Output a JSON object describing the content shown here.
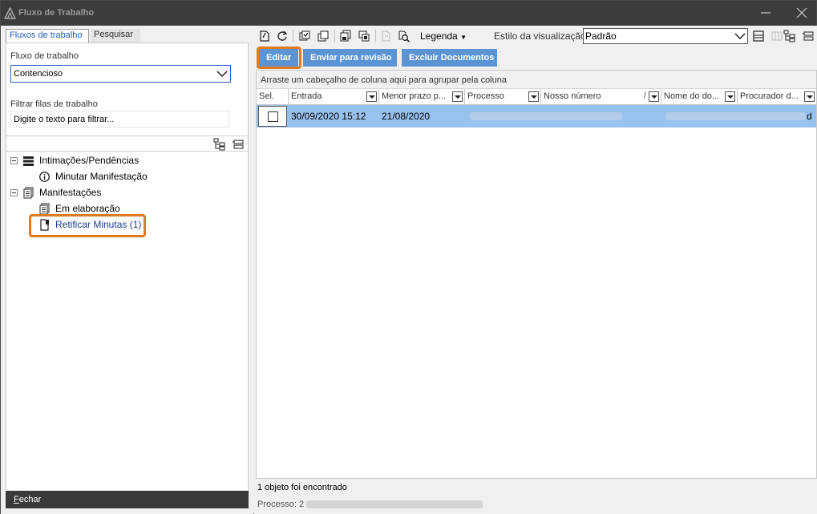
{
  "window": {
    "title": "Fluxo de Trabalho"
  },
  "left": {
    "tabs": [
      {
        "label": "Fluxos de trabalho"
      },
      {
        "label": "Pesquisar"
      }
    ],
    "workflow_label": "Fluxo de trabalho",
    "workflow_value": "Contencioso",
    "filter_label": "Filtrar filas de trabalho",
    "filter_value": "Digite o texto para filtrar...",
    "tree": [
      {
        "label": "Intimações/Pendências",
        "icon": "list-icon"
      },
      {
        "label": "Minutar Manifestação",
        "icon": "info-icon"
      },
      {
        "label": "Manifestações",
        "icon": "documents-icon"
      },
      {
        "label": "Em elaboração",
        "icon": "documents-icon"
      },
      {
        "label": "Retificar Minutas (1)",
        "icon": "document-flag-icon"
      }
    ],
    "close_prefix": "F",
    "close_rest": "echar"
  },
  "right": {
    "legend_label": "Legenda",
    "view_style_label": "Estilo da visualização",
    "view_style_value": "Padrão",
    "actions": {
      "edit": "Editar",
      "send": "Enviar para revisão",
      "delete": "Excluir Documentos"
    },
    "group_hint": "Arraste um cabeçalho de coluna aqui para agrupar pela coluna",
    "columns": {
      "sel": "Sel.",
      "entrada": "Entrada",
      "prazo": "Menor prazo p...",
      "processo": "Processo",
      "nosso": "Nosso número",
      "sort": "/",
      "nome": "Nome do do...",
      "procurador": "Procurador d..."
    },
    "rows": [
      {
        "entrada": "30/09/2020 15:12",
        "prazo": "21/08/2020",
        "tail": "d"
      }
    ],
    "status_found": "1 objeto foi encontrado",
    "status_process": "Processo: 2"
  },
  "colors": {
    "accent": "#e07a1e",
    "action_button": "#5b93d3",
    "selected_row": "#98c2ee",
    "titlebar": "#3c3c3c"
  }
}
